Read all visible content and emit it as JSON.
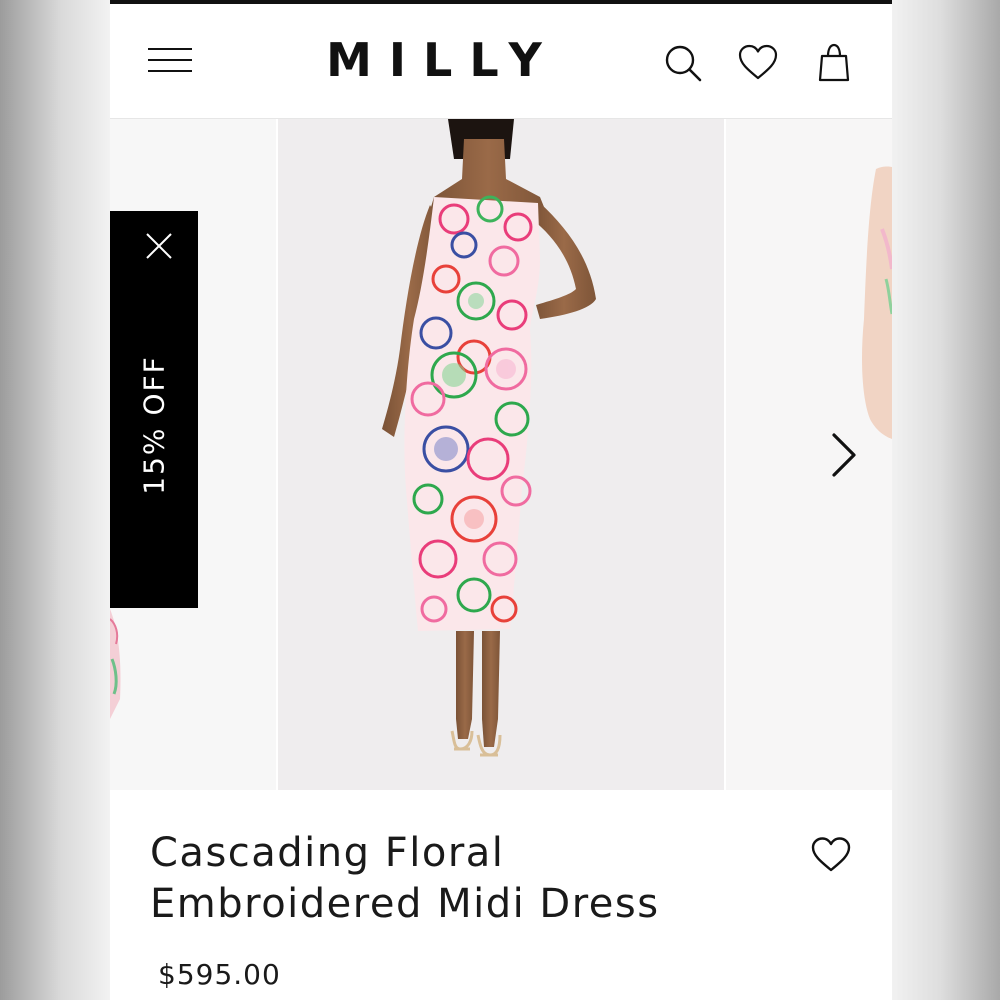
{
  "header": {
    "brand": "MILLY",
    "menu_icon": "hamburger-menu-icon",
    "search_icon": "search-icon",
    "wishlist_icon": "heart-icon",
    "bag_icon": "shopping-bag-icon"
  },
  "promo": {
    "label": "15% OFF",
    "close_icon": "close-icon"
  },
  "gallery": {
    "next_icon": "chevron-right-icon"
  },
  "product": {
    "name_line1": "Cascading Floral",
    "name_line2": "Embroidered Midi Dress",
    "price": "$595.00",
    "wishlist_icon": "heart-icon"
  },
  "colors": {
    "brand_black": "#111111",
    "background": "#ffffff"
  }
}
